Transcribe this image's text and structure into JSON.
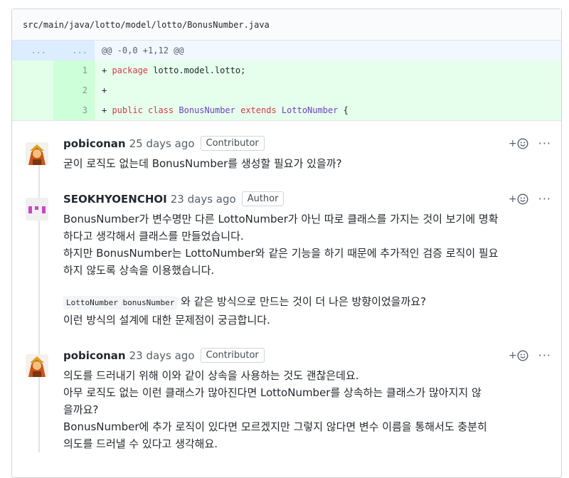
{
  "file": {
    "path": "src/main/java/lotto/model/lotto/BonusNumber.java"
  },
  "diff": {
    "hunk": {
      "left": "...",
      "right": "...",
      "text": "@@ -0,0 +1,12 @@"
    },
    "lines": [
      {
        "num": "1",
        "plus": "+ ",
        "kw1": "package",
        "rest": " lotto.model.lotto;"
      },
      {
        "num": "2",
        "plus": "+",
        "kw1": "",
        "rest": ""
      },
      {
        "num": "3",
        "plus": "+ ",
        "kw1": "public class",
        "cls1": "BonusNumber",
        "kw2": "extends",
        "cls2": "LottoNumber",
        "tail": " {"
      }
    ]
  },
  "comments": [
    {
      "author": "pobiconan",
      "time": "25 days ago",
      "badge": "Contributor",
      "lines": [
        "굳이 로직도 없는데 BonusNumber를 생성할 필요가 있을까?"
      ]
    },
    {
      "author": "SEOKHYOENCHOI",
      "time": "23 days ago",
      "badge": "Author",
      "lines": [
        "BonusNumber가 변수명만 다른 LottoNumber가 아닌 따로 클래스를 가지는 것이 보기에 명확",
        "하다고 생각해서 클래스를 만들었습니다.",
        "하지만 BonusNumber는 LottoNumber와 같은 기능을 하기 때문에 추가적인 검증 로직이 필요",
        "하지 않도록 상속을 이용했습니다."
      ],
      "code": "LottoNumber bonusNumber",
      "after_code": " 와 같은 방식으로 만드는 것이 더 나은 방향이었을까요?",
      "last": "이런 방식의 설계에 대한 문제점이 궁금합니다."
    },
    {
      "author": "pobiconan",
      "time": "23 days ago",
      "badge": "Contributor",
      "lines": [
        "의도를 드러내기 위해 이와 같이 상속을 사용하는 것도 괜찮은데요.",
        "아무 로직도 없는 이런 클래스가 많아진다면 LottoNumber를 상속하는 클래스가 많아지지 않",
        "을까요?",
        "BonusNumber에 추가 로직이 있다면 모르겠지만 그렇지 않다면 변수 이름을 통해서도 충분히",
        "의도를 드러낼 수 있다고 생각해요."
      ]
    }
  ],
  "actions": {
    "react": "+",
    "more": "···"
  }
}
